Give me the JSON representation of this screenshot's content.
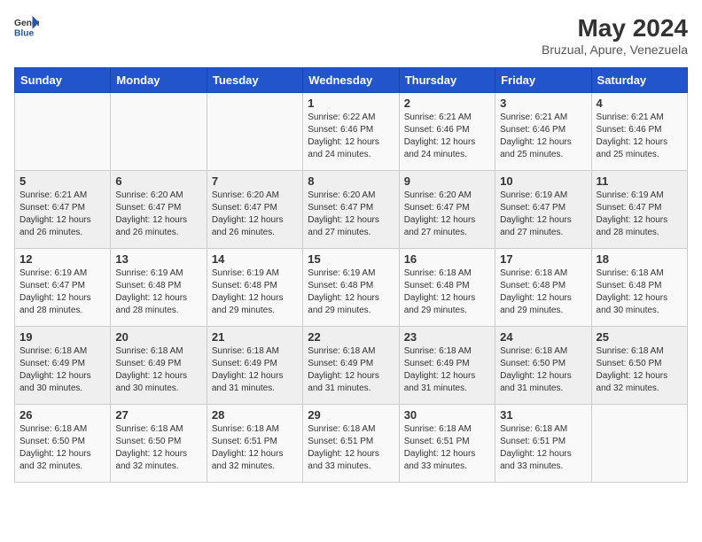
{
  "header": {
    "logo_general": "General",
    "logo_blue": "Blue",
    "month_year": "May 2024",
    "location": "Bruzual, Apure, Venezuela"
  },
  "days_of_week": [
    "Sunday",
    "Monday",
    "Tuesday",
    "Wednesday",
    "Thursday",
    "Friday",
    "Saturday"
  ],
  "weeks": [
    [
      {
        "day": "",
        "info": ""
      },
      {
        "day": "",
        "info": ""
      },
      {
        "day": "",
        "info": ""
      },
      {
        "day": "1",
        "info": "Sunrise: 6:22 AM\nSunset: 6:46 PM\nDaylight: 12 hours and 24 minutes."
      },
      {
        "day": "2",
        "info": "Sunrise: 6:21 AM\nSunset: 6:46 PM\nDaylight: 12 hours and 24 minutes."
      },
      {
        "day": "3",
        "info": "Sunrise: 6:21 AM\nSunset: 6:46 PM\nDaylight: 12 hours and 25 minutes."
      },
      {
        "day": "4",
        "info": "Sunrise: 6:21 AM\nSunset: 6:46 PM\nDaylight: 12 hours and 25 minutes."
      }
    ],
    [
      {
        "day": "5",
        "info": "Sunrise: 6:21 AM\nSunset: 6:47 PM\nDaylight: 12 hours and 26 minutes."
      },
      {
        "day": "6",
        "info": "Sunrise: 6:20 AM\nSunset: 6:47 PM\nDaylight: 12 hours and 26 minutes."
      },
      {
        "day": "7",
        "info": "Sunrise: 6:20 AM\nSunset: 6:47 PM\nDaylight: 12 hours and 26 minutes."
      },
      {
        "day": "8",
        "info": "Sunrise: 6:20 AM\nSunset: 6:47 PM\nDaylight: 12 hours and 27 minutes."
      },
      {
        "day": "9",
        "info": "Sunrise: 6:20 AM\nSunset: 6:47 PM\nDaylight: 12 hours and 27 minutes."
      },
      {
        "day": "10",
        "info": "Sunrise: 6:19 AM\nSunset: 6:47 PM\nDaylight: 12 hours and 27 minutes."
      },
      {
        "day": "11",
        "info": "Sunrise: 6:19 AM\nSunset: 6:47 PM\nDaylight: 12 hours and 28 minutes."
      }
    ],
    [
      {
        "day": "12",
        "info": "Sunrise: 6:19 AM\nSunset: 6:47 PM\nDaylight: 12 hours and 28 minutes."
      },
      {
        "day": "13",
        "info": "Sunrise: 6:19 AM\nSunset: 6:48 PM\nDaylight: 12 hours and 28 minutes."
      },
      {
        "day": "14",
        "info": "Sunrise: 6:19 AM\nSunset: 6:48 PM\nDaylight: 12 hours and 29 minutes."
      },
      {
        "day": "15",
        "info": "Sunrise: 6:19 AM\nSunset: 6:48 PM\nDaylight: 12 hours and 29 minutes."
      },
      {
        "day": "16",
        "info": "Sunrise: 6:18 AM\nSunset: 6:48 PM\nDaylight: 12 hours and 29 minutes."
      },
      {
        "day": "17",
        "info": "Sunrise: 6:18 AM\nSunset: 6:48 PM\nDaylight: 12 hours and 29 minutes."
      },
      {
        "day": "18",
        "info": "Sunrise: 6:18 AM\nSunset: 6:48 PM\nDaylight: 12 hours and 30 minutes."
      }
    ],
    [
      {
        "day": "19",
        "info": "Sunrise: 6:18 AM\nSunset: 6:49 PM\nDaylight: 12 hours and 30 minutes."
      },
      {
        "day": "20",
        "info": "Sunrise: 6:18 AM\nSunset: 6:49 PM\nDaylight: 12 hours and 30 minutes."
      },
      {
        "day": "21",
        "info": "Sunrise: 6:18 AM\nSunset: 6:49 PM\nDaylight: 12 hours and 31 minutes."
      },
      {
        "day": "22",
        "info": "Sunrise: 6:18 AM\nSunset: 6:49 PM\nDaylight: 12 hours and 31 minutes."
      },
      {
        "day": "23",
        "info": "Sunrise: 6:18 AM\nSunset: 6:49 PM\nDaylight: 12 hours and 31 minutes."
      },
      {
        "day": "24",
        "info": "Sunrise: 6:18 AM\nSunset: 6:50 PM\nDaylight: 12 hours and 31 minutes."
      },
      {
        "day": "25",
        "info": "Sunrise: 6:18 AM\nSunset: 6:50 PM\nDaylight: 12 hours and 32 minutes."
      }
    ],
    [
      {
        "day": "26",
        "info": "Sunrise: 6:18 AM\nSunset: 6:50 PM\nDaylight: 12 hours and 32 minutes."
      },
      {
        "day": "27",
        "info": "Sunrise: 6:18 AM\nSunset: 6:50 PM\nDaylight: 12 hours and 32 minutes."
      },
      {
        "day": "28",
        "info": "Sunrise: 6:18 AM\nSunset: 6:51 PM\nDaylight: 12 hours and 32 minutes."
      },
      {
        "day": "29",
        "info": "Sunrise: 6:18 AM\nSunset: 6:51 PM\nDaylight: 12 hours and 33 minutes."
      },
      {
        "day": "30",
        "info": "Sunrise: 6:18 AM\nSunset: 6:51 PM\nDaylight: 12 hours and 33 minutes."
      },
      {
        "day": "31",
        "info": "Sunrise: 6:18 AM\nSunset: 6:51 PM\nDaylight: 12 hours and 33 minutes."
      },
      {
        "day": "",
        "info": ""
      }
    ]
  ]
}
